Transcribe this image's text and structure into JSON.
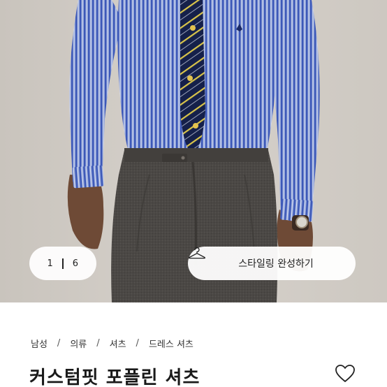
{
  "gallery": {
    "current": "1",
    "total": "6",
    "styling_button_label": "스타일링 완성하기",
    "hanger_icon": "hanger-icon"
  },
  "breadcrumb": [
    {
      "label": "남성"
    },
    {
      "label": "의류"
    },
    {
      "label": "셔츠"
    },
    {
      "label": "드레스 셔츠"
    }
  ],
  "breadcrumb_separator": "/",
  "product": {
    "title": "커스텀핏 포플린 셔츠",
    "wishlist_icon": "heart-outline-icon"
  },
  "colors": {
    "background": "#ffffff",
    "pill_background": "#ffffff",
    "text": "#1a1a1a"
  }
}
